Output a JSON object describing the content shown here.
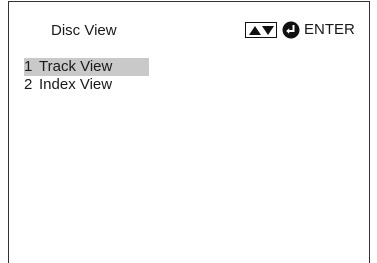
{
  "header": {
    "title": "Disc View",
    "enter_label": "ENTER",
    "updown_icon": "up-down-arrows-icon",
    "enter_icon": "enter-return-icon"
  },
  "menu": {
    "items": [
      {
        "number": "1",
        "label": "Track View",
        "selected": true
      },
      {
        "number": "2",
        "label": "Index View",
        "selected": false
      }
    ]
  },
  "colors": {
    "background": "#ffffff",
    "text": "#1a1a1a",
    "selection_highlight": "#c9c9c9",
    "border": "#333333"
  }
}
